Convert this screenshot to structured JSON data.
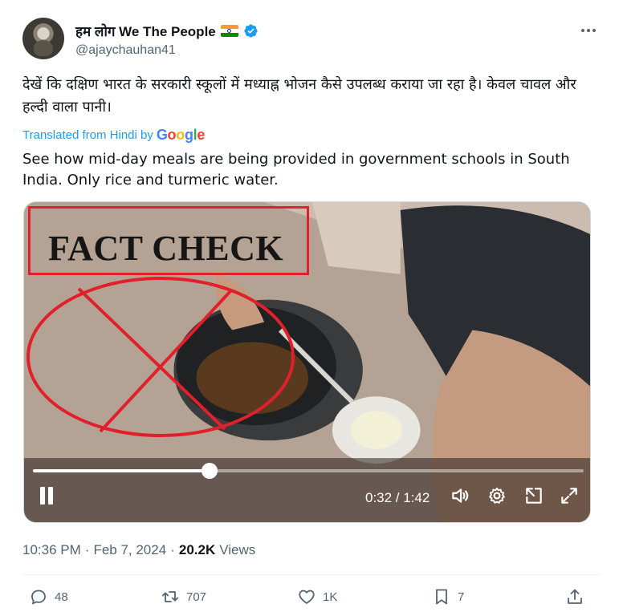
{
  "author": {
    "display_name": "हम लोग We The People",
    "handle": "@ajaychauhan41",
    "verified": true,
    "flag": "india-flag-emoji"
  },
  "tweet": {
    "hindi_text": "देखें कि दक्षिण भारत के सरकारी स्कूलों में मध्याह्न भोजन कैसे उपलब्ध कराया जा रहा है। केवल चावल और हल्दी वाला पानी।",
    "translated_from": "Translated from Hindi by",
    "translator": "Google",
    "english_text": "See how mid-day meals are being provided in government schools in South India. Only rice and turmeric water."
  },
  "video": {
    "overlay_label": "FACT CHECK",
    "time_display": "0:32 / 1:42",
    "progress_fraction": 0.32,
    "overlay_color": "#e0202a"
  },
  "meta": {
    "time": "10:36 PM",
    "separator": "·",
    "date": "Feb 7, 2024",
    "views_count": "20.2K",
    "views_label": "Views"
  },
  "actions": {
    "replies": "48",
    "reposts": "707",
    "likes": "1K",
    "bookmarks": "7"
  },
  "colors": {
    "accent": "#1d9bf0",
    "secondary_text": "#536471",
    "primary_text": "#0f1419"
  }
}
